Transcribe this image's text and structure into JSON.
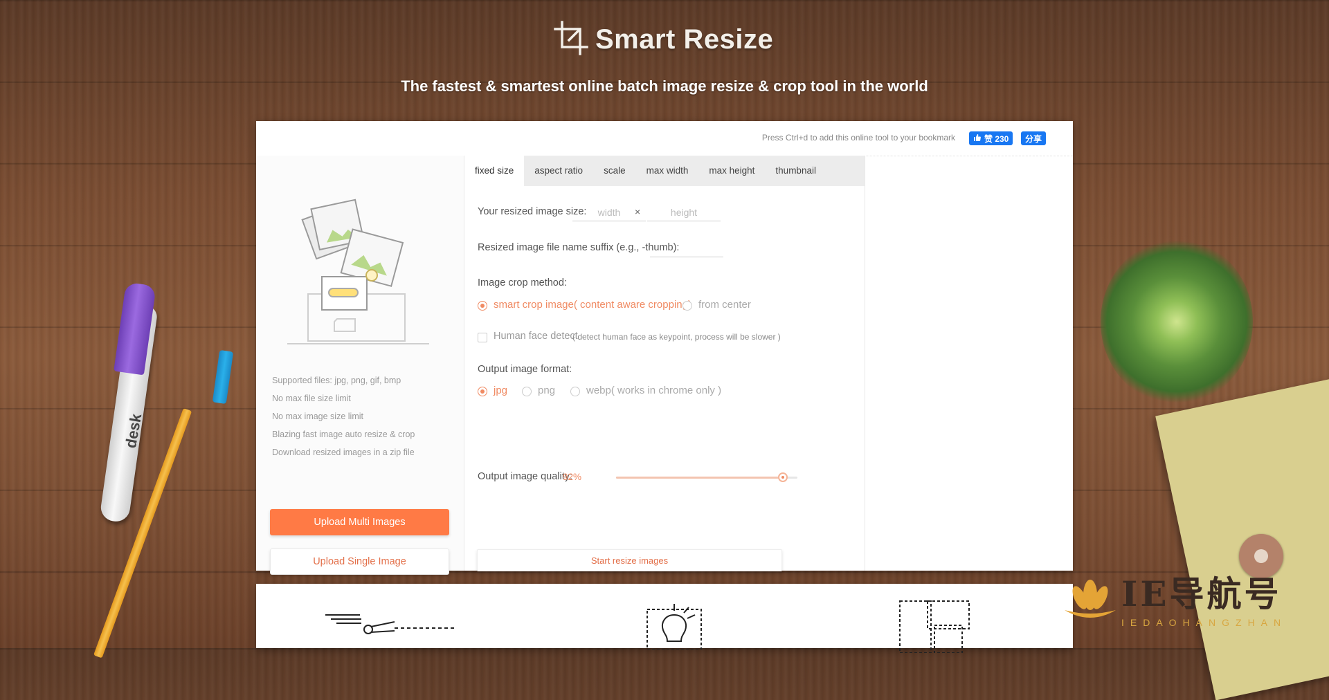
{
  "header": {
    "title": "Smart Resize",
    "tagline": "The fastest & smartest online batch image resize & crop tool in the world"
  },
  "decorations": {
    "marker_text": "desk"
  },
  "topbar": {
    "bookmark_hint": "Press Ctrl+d to add this online tool to your bookmark",
    "like_label": "赞 230",
    "share_label": "分享"
  },
  "sidebar": {
    "features": [
      "Supported files: jpg, png, gif, bmp",
      "No max file size limit",
      "No max image size limit",
      "Blazing fast image auto resize & crop",
      "Download resized images in a zip file"
    ],
    "upload_multi_label": "Upload Multi Images",
    "upload_single_label": "Upload Single Image"
  },
  "tabs": [
    {
      "label": "fixed size",
      "active": true
    },
    {
      "label": "aspect ratio",
      "active": false
    },
    {
      "label": "scale",
      "active": false
    },
    {
      "label": "max width",
      "active": false
    },
    {
      "label": "max height",
      "active": false
    },
    {
      "label": "thumbnail",
      "active": false
    }
  ],
  "form": {
    "size_label": "Your resized image size:",
    "width_placeholder": "width",
    "times": "×",
    "height_placeholder": "height",
    "suffix_label": "Resized image file name suffix (e.g., -thumb):",
    "suffix_value": "",
    "crop_label": "Image crop method:",
    "crop_options": [
      {
        "label": "smart crop image( content aware cropping)",
        "selected": true
      },
      {
        "label": "from center",
        "selected": false
      }
    ],
    "face_detect_label": "Human face detect",
    "face_detect_checked": false,
    "face_detect_note": "( detect human face as keypoint, process will be slower )",
    "format_label": "Output image format:",
    "format_options": [
      {
        "label": "jpg",
        "selected": true
      },
      {
        "label": "png",
        "selected": false
      },
      {
        "label": "webp( works in chrome only )",
        "selected": false
      }
    ],
    "quality_label": "Output image quality:",
    "quality_value": "92%",
    "quality_fraction": 0.92,
    "start_label": "Start resize images"
  },
  "watermark": {
    "text": "IE导航号",
    "subtext": "IEDAOHANGZHAN"
  },
  "colors": {
    "accent": "#ff7a45",
    "accent_text": "#f08a62",
    "facebook": "#1877f2"
  }
}
